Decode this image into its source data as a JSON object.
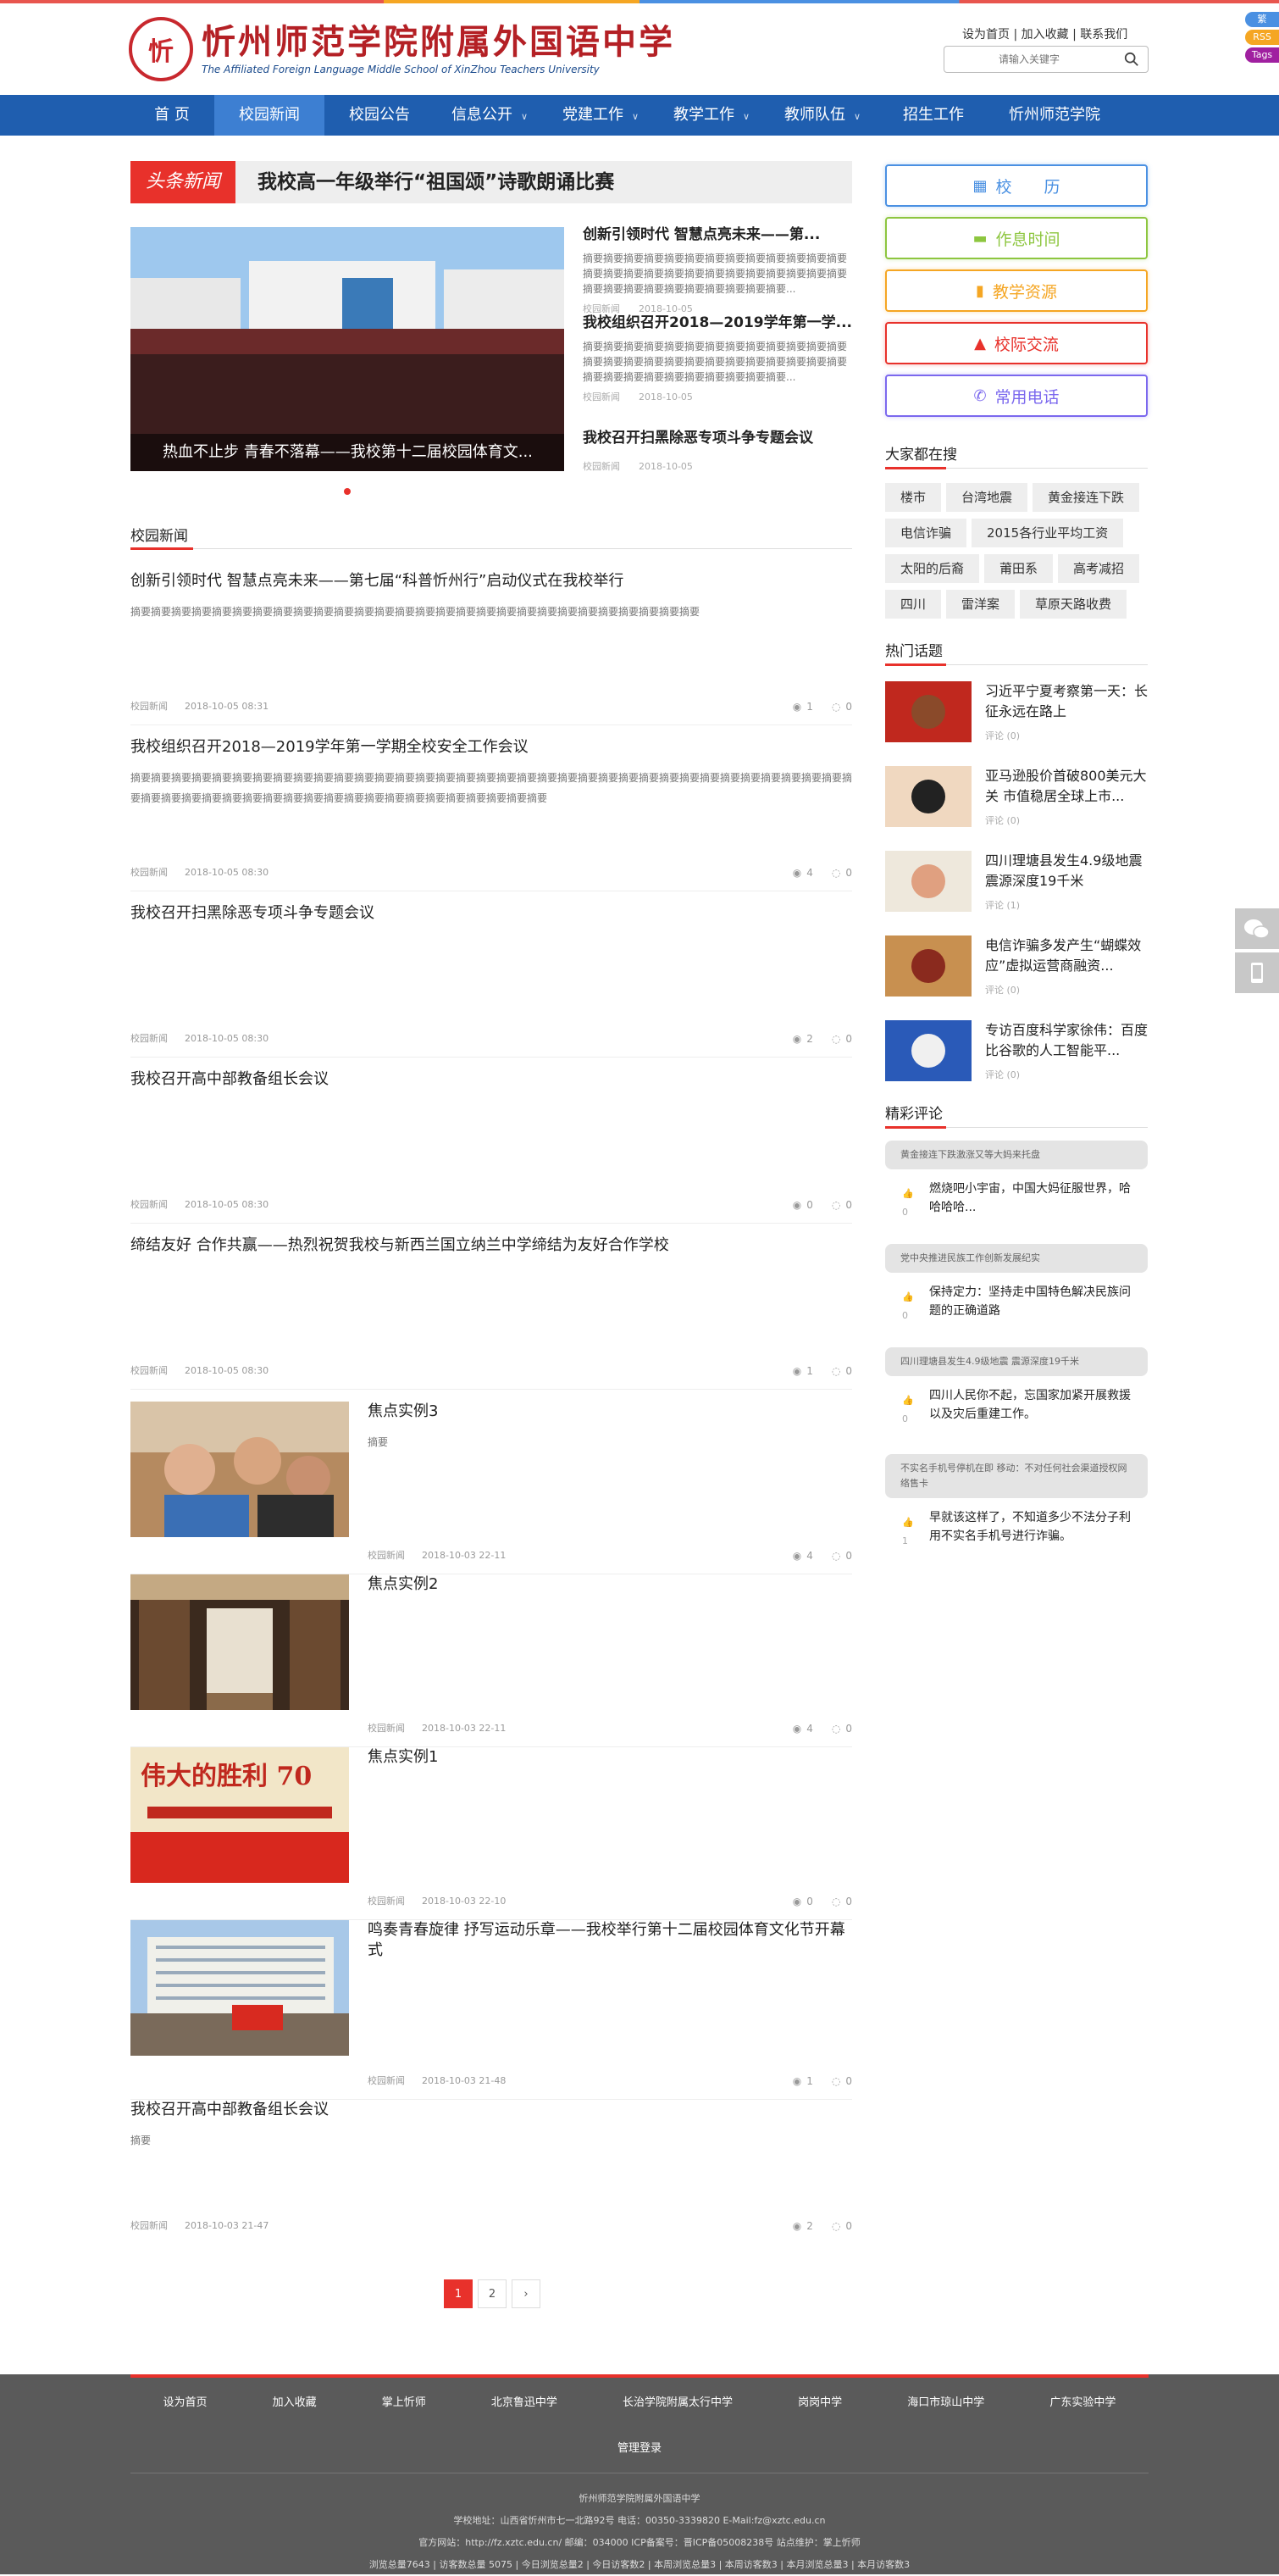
{
  "site": {
    "name_cn": "忻州师范学院附属外国语中学",
    "name_en": "The Affiliated Foreign Language Middle School of XinZhou Teachers University",
    "seal_char": "忻",
    "top_links": [
      "设为首页",
      "加入收藏",
      "联系我们"
    ],
    "search_placeholder": "请输入关键字",
    "side_badges": [
      "繁",
      "RSS",
      "Tags"
    ]
  },
  "nav": [
    {
      "label": "首 页",
      "dropdown": false
    },
    {
      "label": "校园新闻",
      "dropdown": false,
      "active": true
    },
    {
      "label": "校园公告",
      "dropdown": false
    },
    {
      "label": "信息公开",
      "dropdown": true
    },
    {
      "label": "党建工作",
      "dropdown": true
    },
    {
      "label": "教学工作",
      "dropdown": true
    },
    {
      "label": "教师队伍",
      "dropdown": true
    },
    {
      "label": "招生工作",
      "dropdown": false
    },
    {
      "label": "忻州师范学院",
      "dropdown": false
    }
  ],
  "headline": {
    "tag": "头条新闻",
    "title": "我校高一年级举行“祖国颂”诗歌朗诵比赛"
  },
  "slider": {
    "caption": "热血不止步 青春不落幕——我校第十二届校园体育文..."
  },
  "featured": [
    {
      "title": "创新引领时代 智慧点亮未来——第...",
      "summary": "摘要摘要摘要摘要摘要摘要摘要摘要摘要摘要摘要摘要摘要摘要摘要摘要摘要摘要摘要摘要摘要摘要摘要摘要摘要摘要摘要摘要摘要摘要摘要摘要摘要摘要摘要摘要...",
      "category": "校园新闻",
      "date": "2018-10-05"
    },
    {
      "title": "我校组织召开2018—2019学年第一学...",
      "summary": "摘要摘要摘要摘要摘要摘要摘要摘要摘要摘要摘要摘要摘要摘要摘要摘要摘要摘要摘要摘要摘要摘要摘要摘要摘要摘要摘要摘要摘要摘要摘要摘要摘要摘要摘要摘要...",
      "category": "校园新闻",
      "date": "2018-10-05"
    },
    {
      "title": "我校召开扫黑除恶专项斗争专题会议",
      "summary": "",
      "category": "校园新闻",
      "date": "2018-10-05"
    }
  ],
  "news_section_title": "校园新闻",
  "news": [
    {
      "title": "创新引领时代 智慧点亮未来——第七届“科普忻州行”启动仪式在我校举行",
      "summary": "摘要摘要摘要摘要摘要摘要摘要摘要摘要摘要摘要摘要摘要摘要摘要摘要摘要摘要摘要摘要摘要摘要摘要摘要摘要摘要摘要摘要",
      "category": "校园新闻",
      "date": "2018-10-05 08:31",
      "views": "1",
      "comments": "0"
    },
    {
      "title": "我校组织召开2018—2019学年第一学期全校安全工作会议",
      "summary": "摘要摘要摘要摘要摘要摘要摘要摘要摘要摘要摘要摘要摘要摘要摘要摘要摘要摘要摘要摘要摘要摘要摘要摘要摘要摘要摘要摘要摘要摘要摘要摘要摘要摘要摘要摘要摘要摘要摘要摘要摘要摘要摘要摘要摘要摘要摘要摘要摘要摘要摘要摘要摘要摘要摘要摘要",
      "category": "校园新闻",
      "date": "2018-10-05 08:30",
      "views": "4",
      "comments": "0"
    },
    {
      "title": "我校召开扫黑除恶专项斗争专题会议",
      "summary": "",
      "category": "校园新闻",
      "date": "2018-10-05 08:30",
      "views": "2",
      "comments": "0"
    },
    {
      "title": "我校召开高中部教备组长会议",
      "summary": "",
      "category": "校园新闻",
      "date": "2018-10-05 08:30",
      "views": "0",
      "comments": "0"
    },
    {
      "title": "缔结友好 合作共赢——热烈祝贺我校与新西兰国立纳兰中学缔结为友好合作学校",
      "summary": "",
      "category": "校园新闻",
      "date": "2018-10-05 08:30",
      "views": "1",
      "comments": "0"
    }
  ],
  "pic_news": [
    {
      "title": "焦点实例3",
      "summary": "摘要",
      "category": "校园新闻",
      "date": "2018-10-03 22-11",
      "views": "4",
      "comments": "0"
    },
    {
      "title": "焦点实例2",
      "summary": "",
      "category": "校园新闻",
      "date": "2018-10-03 22-11",
      "views": "4",
      "comments": "0"
    },
    {
      "title": "焦点实例1",
      "summary": "",
      "category": "校园新闻",
      "date": "2018-10-03 22-10",
      "views": "0",
      "comments": "0",
      "thumb_text": "伟大的胜利 70"
    },
    {
      "title": "鸣奏青春旋律 抒写运动乐章——我校举行第十二届校园体育文化节开幕式",
      "summary": "",
      "category": "校园新闻",
      "date": "2018-10-03 21-48",
      "views": "1",
      "comments": "0"
    }
  ],
  "last_news": {
    "title": "我校召开高中部教备组长会议",
    "summary": "摘要",
    "category": "校园新闻",
    "date": "2018-10-03 21-47",
    "views": "2",
    "comments": "0"
  },
  "pager": [
    "1",
    "2",
    "›"
  ],
  "quick_buttons": [
    {
      "label": "校　　历",
      "icon": "calendar-icon",
      "glyph": "▦",
      "color": "#4a90e2"
    },
    {
      "label": "作息时间",
      "icon": "bed-icon",
      "glyph": "▬",
      "color": "#8dc63f"
    },
    {
      "label": "教学资源",
      "icon": "book-icon",
      "glyph": "▮",
      "color": "#f5a623"
    },
    {
      "label": "校际交流",
      "icon": "bank-icon",
      "glyph": "▲",
      "color": "#e8312b"
    },
    {
      "label": "常用电话",
      "icon": "phone-icon",
      "glyph": "✆",
      "color": "#7b68ee"
    }
  ],
  "hot_search_title": "大家都在搜",
  "tags": [
    "楼市",
    "台湾地震",
    "黄金接连下跌",
    "电信诈骗",
    "2015各行业平均工资",
    "太阳的后裔",
    "莆田系",
    "高考减招",
    "四川",
    "雷洋案",
    "草原天路收费"
  ],
  "hot_topics_title": "热门话题",
  "hot_topics": [
    {
      "title": "习近平宁夏考察第一天：长征永远在路上",
      "comments": "评论 (0)"
    },
    {
      "title": "亚马逊股价首破800美元大关 市值稳居全球上市...",
      "comments": "评论 (0)"
    },
    {
      "title": "四川理塘县发生4.9级地震 震源深度19千米",
      "comments": "评论 (1)"
    },
    {
      "title": "电信诈骗多发产生“蝴蝶效应”虚拟运营商融资...",
      "comments": "评论 (0)"
    },
    {
      "title": "专访百度科学家徐伟：百度比谷歌的人工智能平...",
      "comments": "评论 (0)"
    }
  ],
  "comments_title": "精彩评论",
  "comments": [
    {
      "topic": "黄金接连下跌激涨又等大妈来托盘",
      "text": "燃烧吧小宇宙，中国大妈征服世界，哈哈哈哈...",
      "likes": "0"
    },
    {
      "topic": "党中央推进民族工作创新发展纪实",
      "text": "保持定力：坚持走中国特色解决民族问题的正确道路",
      "likes": "0"
    },
    {
      "topic": "四川理塘县发生4.9级地震 震源深度19千米",
      "text": "四川人民你不起，忘国家加紧开展救援以及灾后重建工作。",
      "likes": "0"
    },
    {
      "topic": "不实名手机号停机在即 移动：不对任何社会渠道授权网络售卡",
      "text": "早就该这样了，不知道多少不法分子利用不实名手机号进行诈骗。",
      "likes": "1"
    }
  ],
  "footer": {
    "links": [
      "设为首页",
      "加入收藏",
      "掌上忻师",
      "北京鲁迅中学",
      "长治学院附属太行中学",
      "岗岗中学",
      "海口市琼山中学",
      "广东实验中学"
    ],
    "login": "管理登录",
    "school": "忻州师范学院附属外国语中学",
    "address": "学校地址：山西省忻州市七一北路92号 电话：00350-3339820 E-Mail:fz@xztc.edu.cn",
    "web": "官方网站：http://fz.xztc.edu.cn/ 邮编：034000 ICP备案号：晋ICP备05008238号 站点维护：掌上忻师",
    "stats": "浏览总量7643 | 访客数总量 5075 | 今日浏览总量2 | 今日访客数2 | 本周浏览总量3 | 本周访客数3 | 本月浏览总量3 | 本月访客数3"
  },
  "colors": {
    "brand_blue": "#1f5eaf",
    "accent_red": "#e8312b"
  }
}
